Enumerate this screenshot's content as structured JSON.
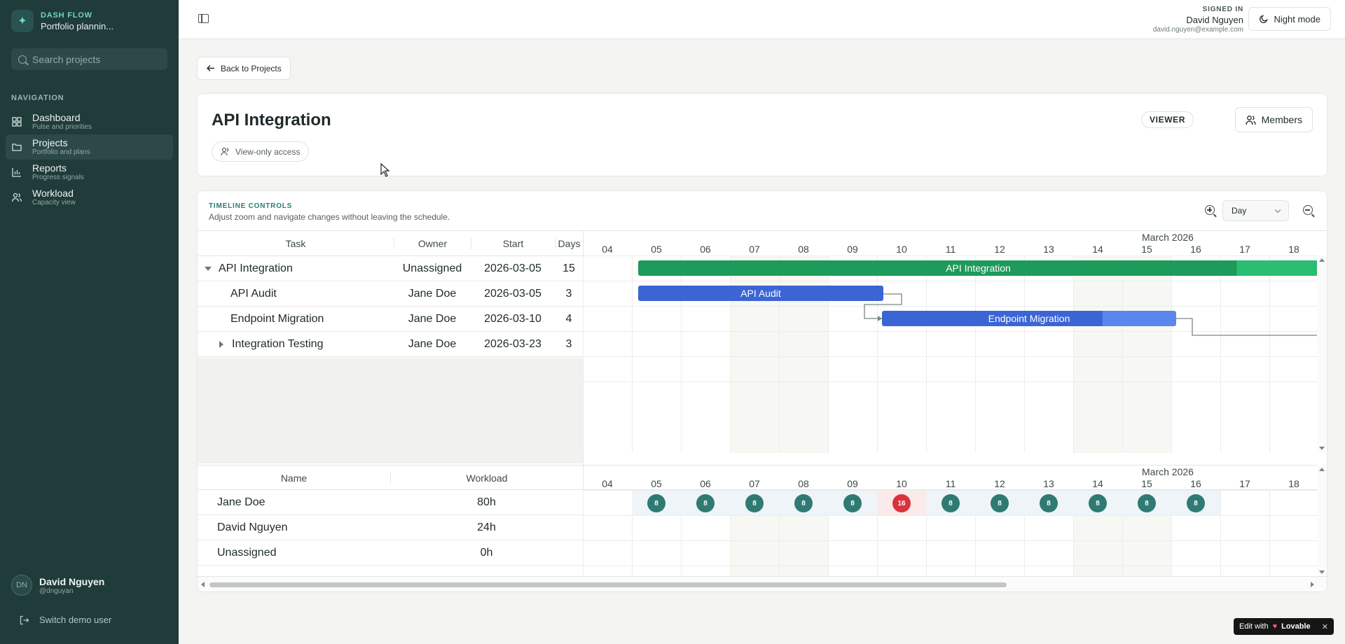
{
  "brand": {
    "kicker": "DASH FLOW",
    "name": "Portfolio plannin..."
  },
  "search": {
    "placeholder": "Search projects"
  },
  "nav": {
    "label": "NAVIGATION",
    "items": [
      {
        "title": "Dashboard",
        "sub": "Pulse and priorities",
        "icon": "grid-icon"
      },
      {
        "title": "Projects",
        "sub": "Portfolio and plans",
        "icon": "folder-icon"
      },
      {
        "title": "Reports",
        "sub": "Progress signals",
        "icon": "bar-chart-icon"
      },
      {
        "title": "Workload",
        "sub": "Capacity view",
        "icon": "users-icon"
      }
    ]
  },
  "user": {
    "initials": "DN",
    "name": "David Nguyen",
    "handle": "@dnguyan",
    "switch_label": "Switch demo user"
  },
  "topbar": {
    "signed_kicker": "SIGNED IN",
    "signed_name": "David Nguyen",
    "signed_email": "david.nguyen@example.com",
    "night_mode": "Night mode"
  },
  "back_label": "Back to Projects",
  "project": {
    "title": "API Integration",
    "access": "View-only access",
    "role": "VIEWER",
    "members_label": "Members"
  },
  "timeline": {
    "kicker": "TIMELINE CONTROLS",
    "subtitle": "Adjust zoom and navigate changes without leaving the schedule.",
    "scale": "Day",
    "month": "March 2026",
    "days": [
      "04",
      "05",
      "06",
      "07",
      "08",
      "09",
      "10",
      "11",
      "12",
      "13",
      "14",
      "15",
      "16",
      "17",
      "18"
    ],
    "task_headers": {
      "task": "Task",
      "owner": "Owner",
      "start": "Start",
      "days": "Days"
    },
    "tasks": [
      {
        "name": "API Integration",
        "owner": "Unassigned",
        "start": "2026-03-05",
        "days": "15"
      },
      {
        "name": "API Audit",
        "owner": "Jane Doe",
        "start": "2026-03-05",
        "days": "3"
      },
      {
        "name": "Endpoint Migration",
        "owner": "Jane Doe",
        "start": "2026-03-10",
        "days": "4"
      },
      {
        "name": "Integration Testing",
        "owner": "Jane Doe",
        "start": "2026-03-23",
        "days": "3"
      }
    ],
    "bars": [
      {
        "label": "API Integration",
        "color": "#1e9a5a",
        "light": "#2bbd72"
      },
      {
        "label": "API Audit",
        "color": "#3b65d4"
      },
      {
        "label": "Endpoint Migration",
        "color": "#3b65d4",
        "light": "#5a86ee"
      }
    ],
    "resource_headers": {
      "name": "Name",
      "workload": "Workload"
    },
    "resources": [
      {
        "name": "Jane Doe",
        "workload": "80h"
      },
      {
        "name": "David Nguyen",
        "workload": "24h"
      },
      {
        "name": "Unassigned",
        "workload": "0h"
      }
    ],
    "jane_loads": [
      "",
      "8",
      "8",
      "8",
      "8",
      "8",
      "16",
      "8",
      "8",
      "8",
      "8",
      "8",
      "8",
      "",
      ""
    ]
  },
  "badge": {
    "edit_with": "Edit with",
    "brand": "Lovable"
  }
}
